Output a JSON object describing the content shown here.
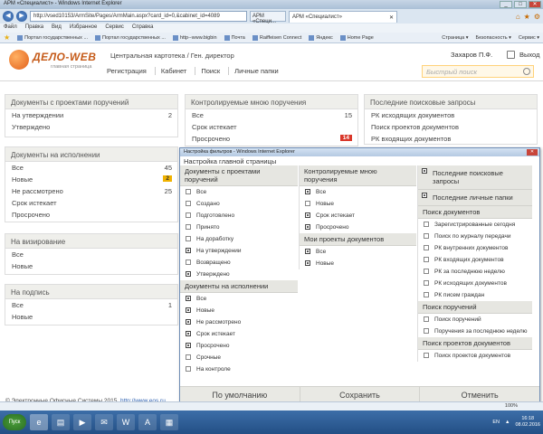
{
  "browser": {
    "title": "АРМ «Специалист» - Windows Internet Explorer",
    "url": "http://vsed10153/ArmSite/Pages/ArmMain.aspx?card_id=0,&cabinet_id=4089",
    "tab_small": "АРМ «Специ...",
    "tab_active": "АРМ «Специалист»",
    "menu": [
      "Файл",
      "Правка",
      "Вид",
      "Избранное",
      "Сервис",
      "Справка"
    ],
    "favorites": [
      "Портал государственных ...",
      "Портал государственных ...",
      "http--www.bigbin",
      "Почта",
      "Raiffeisen Connect",
      "Яндекс",
      "Home Page"
    ],
    "favorites_right": [
      "Страница ▾",
      "Безопасность ▾",
      "Сервис ▾"
    ],
    "zoom": "100%"
  },
  "header": {
    "logo": "ДЕЛО-WEB",
    "logo_sub": "главная страница",
    "crumb": "Центральная картотека / Ген. директор",
    "nav": [
      "Регистрация",
      "Кабинет",
      "Поиск",
      "Личные папки"
    ],
    "user": "Захаров П.Ф.",
    "exit": "Выход",
    "search_placeholder": "Быстрый поиск"
  },
  "panels": {
    "p1": {
      "title": "Документы с проектами поручений",
      "rows": [
        {
          "label": "На утверждении",
          "count": "2"
        },
        {
          "label": "Утверждено",
          "count": ""
        }
      ]
    },
    "p2": {
      "title": "Документы на исполнении",
      "rows": [
        {
          "label": "Все",
          "count": "45"
        },
        {
          "label": "Новые",
          "count": "2"
        },
        {
          "label": "Не рассмотрено",
          "count": "25"
        },
        {
          "label": "Срок истекает",
          "count": ""
        },
        {
          "label": "Просрочено",
          "count": ""
        }
      ]
    },
    "p3": {
      "title": "На визирование",
      "rows": [
        {
          "label": "Все",
          "count": ""
        },
        {
          "label": "Новые",
          "count": ""
        }
      ]
    },
    "p4": {
      "title": "На подпись",
      "rows": [
        {
          "label": "Все",
          "count": "1"
        },
        {
          "label": "Новые",
          "count": ""
        }
      ]
    },
    "p5": {
      "title": "Контролируемые мною поручения",
      "rows": [
        {
          "label": "Все",
          "count": "15"
        },
        {
          "label": "Срок истекает",
          "count": ""
        },
        {
          "label": "Просрочено",
          "count": "14"
        }
      ]
    },
    "p6": {
      "title": "Последние поисковые запросы",
      "rows": [
        {
          "label": "РК исходящих документов"
        },
        {
          "label": "Поиск проектов документов"
        },
        {
          "label": "РК входящих документов"
        }
      ]
    }
  },
  "footer": {
    "text": "© Электронные Офисные Системы 2015,",
    "link": "http://www.eos.ru"
  },
  "dialog": {
    "window_title": "Настройка фильтров - Windows Internet Explorer",
    "heading": "Настройка главной страницы",
    "col1": [
      {
        "title": "Документы с проектами поручений",
        "items": [
          {
            "l": "Все",
            "c": false
          },
          {
            "l": "Создано",
            "c": false
          },
          {
            "l": "Подготовлено",
            "c": false
          },
          {
            "l": "Принято",
            "c": false
          },
          {
            "l": "На доработку",
            "c": false
          },
          {
            "l": "На утверждении",
            "c": true
          },
          {
            "l": "Возвращено",
            "c": false
          },
          {
            "l": "Утверждено",
            "c": true
          }
        ]
      },
      {
        "title": "Документы на исполнении",
        "items": [
          {
            "l": "Все",
            "c": true
          },
          {
            "l": "Новые",
            "c": true
          },
          {
            "l": "Не рассмотрено",
            "c": true
          },
          {
            "l": "Срок истекает",
            "c": true
          },
          {
            "l": "Просрочено",
            "c": true
          },
          {
            "l": "Срочные",
            "c": false
          },
          {
            "l": "На контроле",
            "c": false
          }
        ]
      }
    ],
    "col2": [
      {
        "title": "Контролируемые мною поручения",
        "items": [
          {
            "l": "Все",
            "c": true
          },
          {
            "l": "Новые",
            "c": false
          },
          {
            "l": "Срок истекает",
            "c": true
          },
          {
            "l": "Просрочено",
            "c": true
          }
        ]
      },
      {
        "title": "Мои проекты документов",
        "items": [
          {
            "l": "Все",
            "c": true
          },
          {
            "l": "Новые",
            "c": true
          }
        ]
      }
    ],
    "col3_top": [
      {
        "l": "Последние поисковые запросы",
        "c": true
      },
      {
        "l": "Последние личные папки",
        "c": true
      }
    ],
    "col3": [
      {
        "title": "Поиск документов",
        "items": [
          {
            "l": "Зарегистрированные сегодня",
            "c": false
          },
          {
            "l": "Поиск по журналу передачи",
            "c": false
          },
          {
            "l": "РК внутренних документов",
            "c": false
          },
          {
            "l": "РК входящих документов",
            "c": false
          },
          {
            "l": "РК за последнюю неделю",
            "c": false
          },
          {
            "l": "РК исходящих документов",
            "c": false
          },
          {
            "l": "РК писем граждан",
            "c": false
          }
        ]
      },
      {
        "title": "Поиск поручений",
        "items": [
          {
            "l": "Поиск поручений",
            "c": false
          },
          {
            "l": "Поручения за последнюю неделю",
            "c": false
          }
        ]
      },
      {
        "title": "Поиск проектов документов",
        "items": [
          {
            "l": "Поиск проектов документов",
            "c": false
          }
        ]
      }
    ],
    "buttons": [
      "По умолчанию",
      "Сохранить",
      "Отменить"
    ]
  },
  "taskbar": {
    "start": "Пуск",
    "lang": "EN",
    "time": "16:18",
    "date": "08.02.2016"
  }
}
